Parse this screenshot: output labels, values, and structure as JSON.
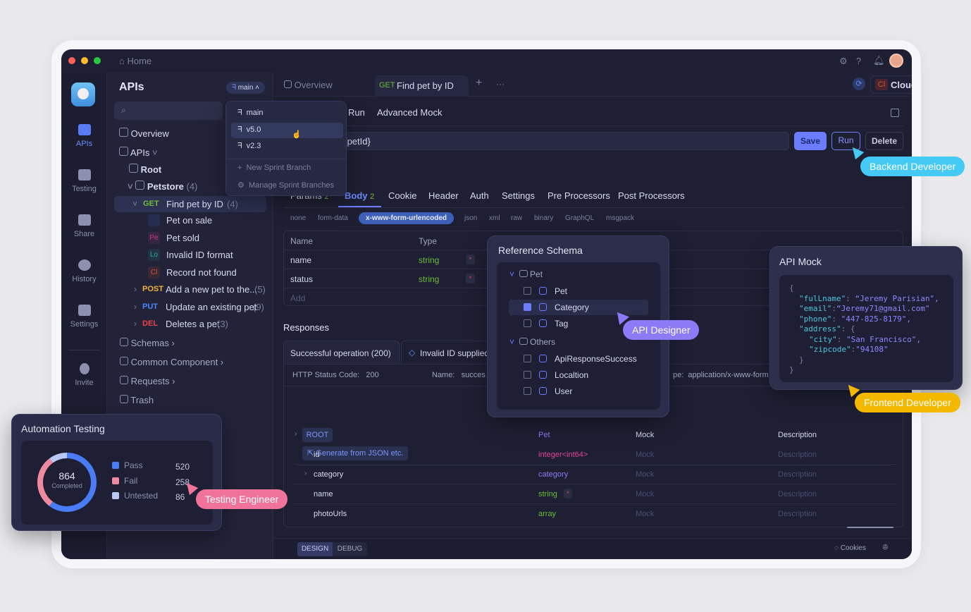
{
  "window": {
    "home": "Home"
  },
  "rail": {
    "items": [
      {
        "label": "APIs",
        "active": true
      },
      {
        "label": "Testing"
      },
      {
        "label": "Share"
      },
      {
        "label": "History"
      },
      {
        "label": "Settings"
      },
      {
        "label": "Invite"
      }
    ]
  },
  "sidebar": {
    "title": "APIs",
    "branch": "main",
    "search_placeholder": "",
    "overview": "Overview",
    "apis": "APIs",
    "root": "Root",
    "petstore": "Petstore",
    "petstore_count": "(4)",
    "get": {
      "method": "GET",
      "name": "Find pet by ID",
      "count": "(4)"
    },
    "examples": [
      {
        "badge": "",
        "label": "Pet on sale",
        "color": "#3d6df2"
      },
      {
        "badge": "Pe",
        "label": "Pet sold",
        "color": "#c23a8a"
      },
      {
        "badge": "Lo",
        "label": "Invalid ID format",
        "color": "#2fa59a"
      },
      {
        "badge": "Cl",
        "label": "Record not found",
        "color": "#d2562f"
      }
    ],
    "endpoints": [
      {
        "method": "POST",
        "name": "Add a new pet to the...",
        "count": "(5)",
        "color": "#f0b43a"
      },
      {
        "method": "PUT",
        "name": "Update an existing pet",
        "count": "(9)",
        "color": "#4b86f7"
      },
      {
        "method": "DEL",
        "name": "Deletes a pet",
        "count": "(3)",
        "color": "#e8434a"
      }
    ],
    "sections": [
      "Schemas",
      "Common Component",
      "Requests",
      "Trash"
    ]
  },
  "branch_menu": {
    "items": [
      "main",
      "v5.0",
      "v2.3"
    ],
    "selected": "v5.0",
    "new": "New Sprint Branch",
    "manage": "Manage Sprint Branches"
  },
  "tabs": {
    "overview": "Overview",
    "active_method": "GET",
    "active_name": "Find pet by ID",
    "add": "+",
    "more": "···"
  },
  "env": {
    "badge": "Cl",
    "name": "Cloud Mock"
  },
  "subtabs": [
    "Run",
    "Advanced Mock"
  ],
  "request": {
    "url": "t/{petId}",
    "save": "Save",
    "run": "Run",
    "delete": "Delete"
  },
  "req_tabs": [
    {
      "label": "Params",
      "count": "2"
    },
    {
      "label": "Body",
      "count": "2",
      "active": true
    },
    {
      "label": "Cookie"
    },
    {
      "label": "Header"
    },
    {
      "label": "Auth"
    },
    {
      "label": "Settings"
    },
    {
      "label": "Pre Processors"
    },
    {
      "label": "Post Processors"
    }
  ],
  "body_types": [
    "none",
    "form-data",
    "x-www-form-urlencoded",
    "json",
    "xml",
    "raw",
    "binary",
    "GraphQL",
    "msgpack"
  ],
  "body_type_selected": "x-www-form-urlencoded",
  "params": {
    "headers": [
      "Name",
      "Type"
    ],
    "rows": [
      {
        "name": "name",
        "type": "string",
        "required": "*"
      },
      {
        "name": "status",
        "type": "string",
        "required": "*"
      }
    ],
    "add": "Add"
  },
  "responses": {
    "title": "Responses",
    "tabs": [
      "Successful operation (200)",
      "Invalid ID supplied"
    ],
    "status_label": "HTTP Status Code:",
    "status": "200",
    "name_label": "Name:",
    "name": "succes",
    "type_label": "pe:",
    "type": "application/x-www-form",
    "generate": "Generate from JSON etc."
  },
  "schema": {
    "root": "ROOT",
    "root_type": "Pet",
    "mock_header": "Mock",
    "desc_header": "Description",
    "rows": [
      {
        "name": "id",
        "type": "integer<int64>",
        "color": "#e0439b"
      },
      {
        "name": "category",
        "type": "category",
        "color": "#8a7cf7",
        "expand": true
      },
      {
        "name": "name",
        "type": "string",
        "color": "#6dbb3a",
        "required": "*"
      },
      {
        "name": "photoUrls",
        "type": "array",
        "color": "#6dbb3a"
      }
    ],
    "mock": "Mock",
    "desc": "Description"
  },
  "bottom": {
    "design": "DESIGN",
    "debug": "DEBUG",
    "cookies": "Cookies"
  },
  "ref_schema": {
    "title": "Reference Schema",
    "groups": [
      {
        "name": "Pet",
        "items": [
          {
            "label": "Pet",
            "checked": false
          },
          {
            "label": "Category",
            "checked": true
          },
          {
            "label": "Tag",
            "checked": false
          }
        ]
      },
      {
        "name": "Others",
        "items": [
          {
            "label": "ApiResponseSuccess",
            "checked": false
          },
          {
            "label": "Localtion",
            "checked": false
          },
          {
            "label": "User",
            "checked": false
          }
        ]
      }
    ]
  },
  "api_mock": {
    "title": "API Mock",
    "lines": [
      {
        "p": "{"
      },
      {
        "k": "\"fulLname\"",
        "p": ": ",
        "v": "“Jeremy Parisian\","
      },
      {
        "k": "\"email\"",
        "p": ":",
        "v": "“Jeremy71@gmail.com\""
      },
      {
        "k": "\"phone\"",
        "p": ": ",
        "v": "\"447-825-8179\","
      },
      {
        "k": "\"address\"",
        "p": ": {"
      },
      {
        "k": "\"city\"",
        "p": ":  ",
        "v": "\"San Francisco\","
      },
      {
        "k": "\"zipcode\"",
        "p": ":",
        "v": "\"94108\""
      },
      {
        "p": "}"
      },
      {
        "p": "}"
      }
    ]
  },
  "testing": {
    "title": "Automation Testing",
    "total": "864",
    "total_label": "Completed",
    "legend": [
      {
        "label": "Pass",
        "value": 520,
        "color": "#4a7cf6"
      },
      {
        "label": "Fail",
        "value": 258,
        "color": "#f08aa0"
      },
      {
        "label": "Untested",
        "value": 86,
        "color": "#b9c8f5"
      }
    ]
  },
  "roles": {
    "backend": "Backend Developer",
    "designer": "API Designer",
    "frontend": "Frontend Developer",
    "tester": "Testing Engineer"
  },
  "colors": {
    "accent": "#6b7cff",
    "backend": "#45c9f5",
    "designer": "#8b7bf7",
    "frontend": "#f5b800",
    "tester": "#f0739a"
  }
}
